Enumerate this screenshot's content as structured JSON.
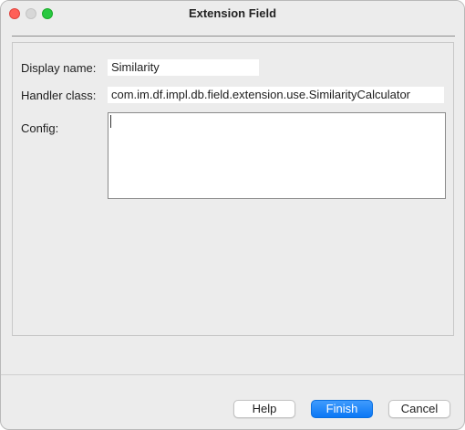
{
  "window": {
    "title": "Extension Field"
  },
  "form": {
    "display_name": {
      "label": "Display name:",
      "value": "Similarity"
    },
    "handler_class": {
      "label": "Handler class:",
      "value": "com.im.df.impl.db.field.extension.use.SimilarityCalculator"
    },
    "config": {
      "label": "Config:",
      "value": ""
    }
  },
  "buttons": {
    "help": "Help",
    "finish": "Finish",
    "cancel": "Cancel"
  },
  "colors": {
    "accent": "#0a77f5",
    "close": "#ff5f57",
    "maximize": "#28c840"
  }
}
